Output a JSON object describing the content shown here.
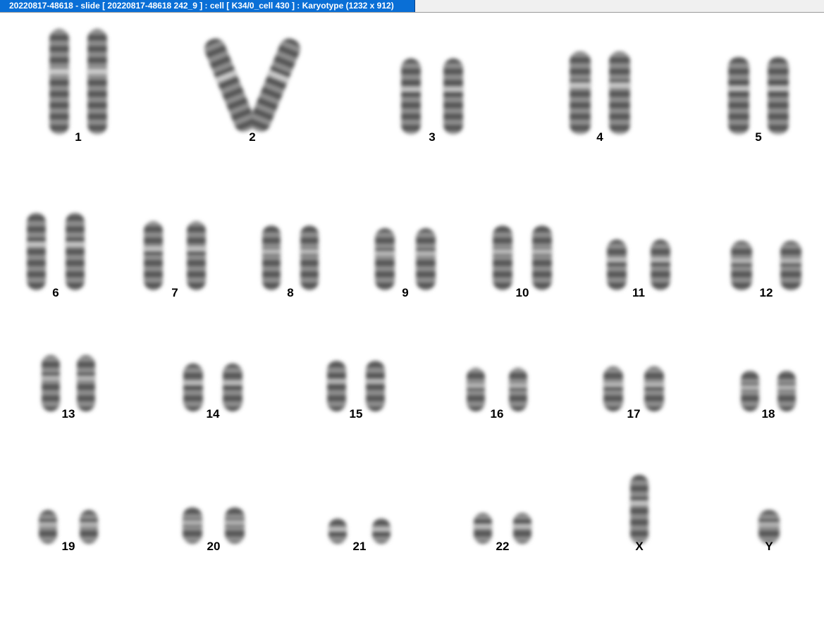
{
  "window": {
    "title": "20220817-48618 - slide [ 20220817-48618 242_9 ] : cell [ K34/0_cell 430 ] : Karyotype  (1232 x 912)"
  },
  "colors": {
    "title_bar": "#0a6fd6",
    "title_text": "#ffffff",
    "background": "#ffffff",
    "label_text": "#000000"
  },
  "karyotype": {
    "chromosome_labels": [
      "1",
      "2",
      "3",
      "4",
      "5",
      "6",
      "7",
      "8",
      "9",
      "10",
      "11",
      "12",
      "13",
      "14",
      "15",
      "16",
      "17",
      "18",
      "19",
      "20",
      "21",
      "22",
      "X",
      "Y"
    ]
  }
}
